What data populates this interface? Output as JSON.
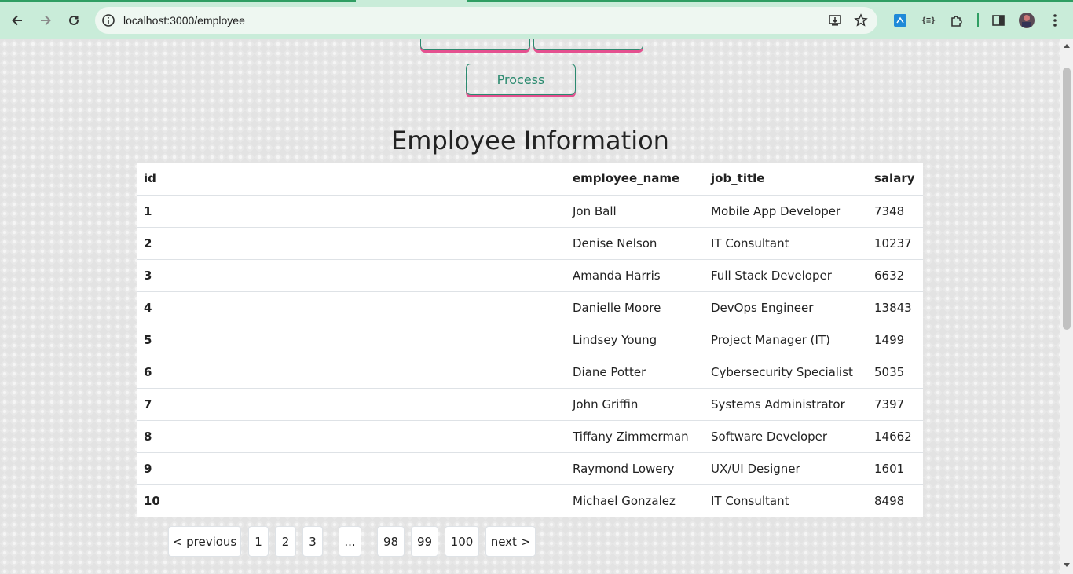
{
  "browser": {
    "url": "localhost:3000/employee"
  },
  "page": {
    "process_button": "Process",
    "title": "Employee Information"
  },
  "table": {
    "headers": [
      "id",
      "employee_name",
      "job_title",
      "salary"
    ],
    "rows": [
      {
        "id": "1",
        "name": "Jon Ball",
        "job": "Mobile App Developer",
        "salary": "7348"
      },
      {
        "id": "2",
        "name": "Denise Nelson",
        "job": "IT Consultant",
        "salary": "10237"
      },
      {
        "id": "3",
        "name": "Amanda Harris",
        "job": "Full Stack Developer",
        "salary": "6632"
      },
      {
        "id": "4",
        "name": "Danielle Moore",
        "job": "DevOps Engineer",
        "salary": "13843"
      },
      {
        "id": "5",
        "name": "Lindsey Young",
        "job": "Project Manager (IT)",
        "salary": "1499"
      },
      {
        "id": "6",
        "name": "Diane Potter",
        "job": "Cybersecurity Specialist",
        "salary": "5035"
      },
      {
        "id": "7",
        "name": "John Griffin",
        "job": "Systems Administrator",
        "salary": "7397"
      },
      {
        "id": "8",
        "name": "Tiffany Zimmerman",
        "job": "Software Developer",
        "salary": "14662"
      },
      {
        "id": "9",
        "name": "Raymond Lowery",
        "job": "UX/UI Designer",
        "salary": "1601"
      },
      {
        "id": "10",
        "name": "Michael Gonzalez",
        "job": "IT Consultant",
        "salary": "8498"
      }
    ]
  },
  "pagination": {
    "previous": "< previous",
    "pages": [
      "1",
      "2",
      "3",
      "...",
      "98",
      "99",
      "100"
    ],
    "next": "next >"
  },
  "colors": {
    "accent_green": "#2b8a6f",
    "accent_pink": "#e4508f",
    "chrome_bg": "#c9ecd9"
  }
}
